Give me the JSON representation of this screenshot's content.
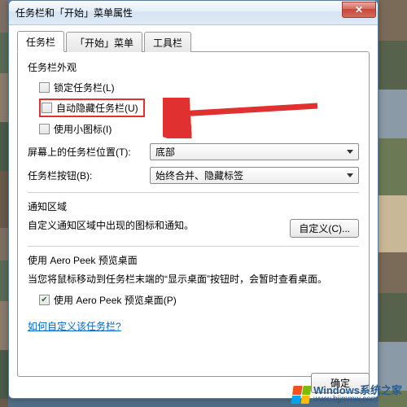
{
  "window": {
    "title": "任务栏和「开始」菜单属性",
    "close_glyph": "✕"
  },
  "tabs": {
    "taskbar": "任务栏",
    "startmenu": "「开始」菜单",
    "toolbars": "工具栏"
  },
  "appearance": {
    "title": "任务栏外观",
    "lock": "锁定任务栏(L)",
    "autohide": "自动隐藏任务栏(U)",
    "smallicons": "使用小图标(I)",
    "position_label": "屏幕上的任务栏位置(T):",
    "position_value": "底部",
    "buttons_label": "任务栏按钮(B):",
    "buttons_value": "始终合并、隐藏标签"
  },
  "notification": {
    "title": "通知区域",
    "desc": "自定义通知区域中出现的图标和通知。",
    "customize_btn": "自定义(C)..."
  },
  "aeropeek": {
    "title": "使用 Aero Peek 预览桌面",
    "desc": "当您将鼠标移动到任务栏末端的“显示桌面”按钮时，会暂时查看桌面。",
    "checkbox_label": "使用 Aero Peek 预览桌面(P)",
    "checked_glyph": "✔"
  },
  "link": {
    "howto": "如何自定义该任务栏?"
  },
  "buttons": {
    "ok": "确定"
  },
  "watermark": {
    "line1": "Windows系统之家",
    "line2": "www.bjjmmw.com"
  }
}
